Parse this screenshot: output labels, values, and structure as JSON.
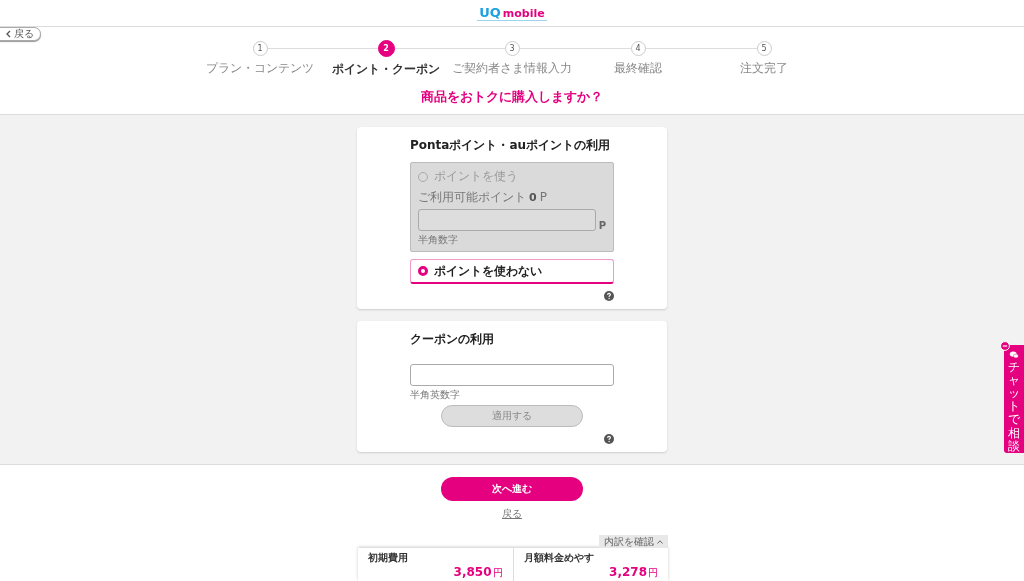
{
  "header": {
    "logo": {
      "part_1": "UQ",
      "part_2": "mobile"
    }
  },
  "back_button": {
    "label": "戻る"
  },
  "steps": [
    {
      "number": "1",
      "label": "プラン・コンテンツ",
      "selected": false
    },
    {
      "number": "2",
      "label": "ポイント・クーポン",
      "selected": true
    },
    {
      "number": "3",
      "label": "ご契約者さま情報入力",
      "selected": false
    },
    {
      "number": "4",
      "label": "最終確認",
      "selected": false
    },
    {
      "number": "5",
      "label": "注文完了",
      "selected": false
    }
  ],
  "heading": "商品をおトクに購入しますか？",
  "points_card": {
    "title": "Pontaポイント・auポイントの利用",
    "options": [
      {
        "kind": "use",
        "label": "ポイントを使う",
        "selected": false,
        "disabled": true,
        "available_label": "ご利用可能ポイント",
        "available_value": "0",
        "available_unit": "P",
        "unit": "P",
        "hint": "半角数字"
      },
      {
        "kind": "plain",
        "label": "ポイントを使わない",
        "selected": true
      }
    ]
  },
  "coupon_card": {
    "title": "クーポンの利用",
    "hint": "半角英数字",
    "apply_button": {
      "label": "適用する",
      "disabled": true
    }
  },
  "next_button": {
    "label": "次へ進む"
  },
  "back_link": {
    "label": "戻る"
  },
  "summary": {
    "toggle": {
      "label": "内訳を確認",
      "expanded": false
    },
    "items": [
      {
        "label": "初期費用",
        "value": "3,850",
        "unit": "円"
      },
      {
        "label": "月額料金めやす",
        "value": "3,278",
        "unit": "円"
      }
    ]
  },
  "chat_widget": {
    "label": "チャットで相談"
  }
}
